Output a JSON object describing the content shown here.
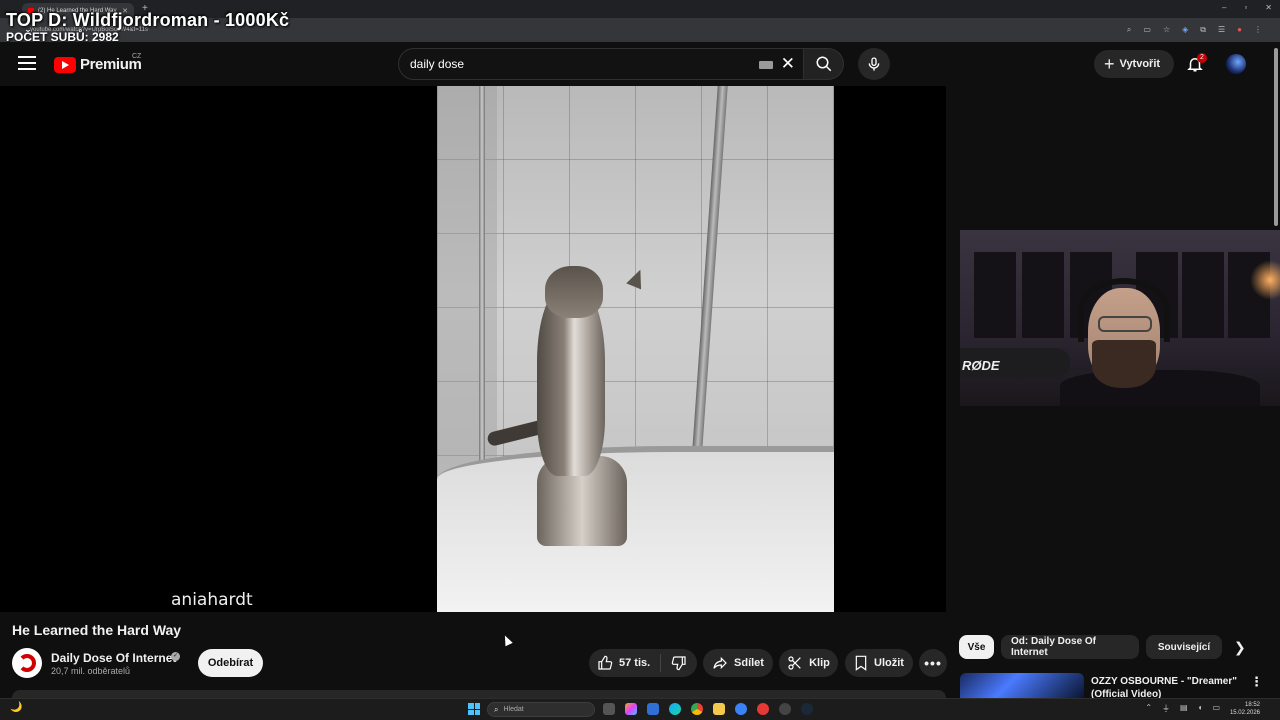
{
  "overlay": {
    "top_line": "TOP D: Wildfjordroman - 1000Kč",
    "sub_line": "POČET SUBŮ: 2982"
  },
  "browser": {
    "tab_title": "(2) He Learned the Hard Way",
    "url": "youtube.com/watch?v=UrpBolSobW4&t=11s"
  },
  "header": {
    "logo_text": "Premium",
    "country": "CZ",
    "search_value": "daily dose",
    "create_label": "Vytvořit",
    "notification_count": "2"
  },
  "video": {
    "watermark": "aniahardt",
    "title": "He Learned the Hard Way"
  },
  "channel": {
    "name": "Daily Dose Of Internet",
    "subscribers": "20,7 mil. odběratelů",
    "subscribe_label": "Odebírat"
  },
  "actions": {
    "likes": "57 tis.",
    "share": "Sdílet",
    "clip": "Klip",
    "save": "Uložit"
  },
  "related": {
    "chips": [
      "Vše",
      "Od: Daily Dose Of Internet",
      "Související"
    ],
    "first_item_title": "OZZY OSBOURNE - \"Dreamer\" (Official Video)"
  },
  "webcam": {
    "mic_brand": "RØDE"
  },
  "taskbar": {
    "search_placeholder": "Hledat",
    "time": "18:52",
    "date": "15.02.2026"
  },
  "colors": {
    "background": "#0f0f0f",
    "brand_red": "#ff0000",
    "chip_bg": "#272727",
    "text": "#f1f1f1"
  }
}
